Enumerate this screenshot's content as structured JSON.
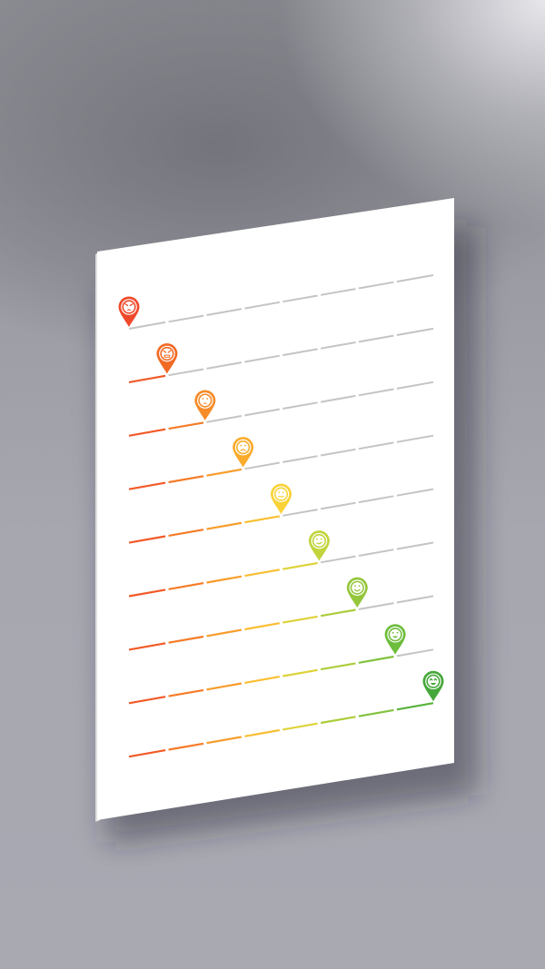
{
  "scene": {
    "description_free": true,
    "background_color": "#a7a7b0",
    "sheet_color": "#ffffff",
    "track_gray": "#c4c4c4"
  },
  "rating_scale": {
    "levels": [
      {
        "icon": "furious-face-icon",
        "color": "#f0492a",
        "level": 0
      },
      {
        "icon": "angry-face-icon",
        "color": "#f36a25",
        "level": 1
      },
      {
        "icon": "upset-face-icon",
        "color": "#f78c2a",
        "level": 2
      },
      {
        "icon": "sad-face-icon",
        "color": "#f9ac2c",
        "level": 3
      },
      {
        "icon": "neutral-face-icon",
        "color": "#f9d238",
        "level": 4
      },
      {
        "icon": "slight-smile-face-icon",
        "color": "#c2d43c",
        "level": 5
      },
      {
        "icon": "smile-face-icon",
        "color": "#94c73c",
        "level": 6
      },
      {
        "icon": "happy-face-icon",
        "color": "#6ebd3d",
        "level": 7
      },
      {
        "icon": "laughing-face-icon",
        "color": "#45a73a",
        "level": 8
      }
    ],
    "segments_per_track": 8
  }
}
